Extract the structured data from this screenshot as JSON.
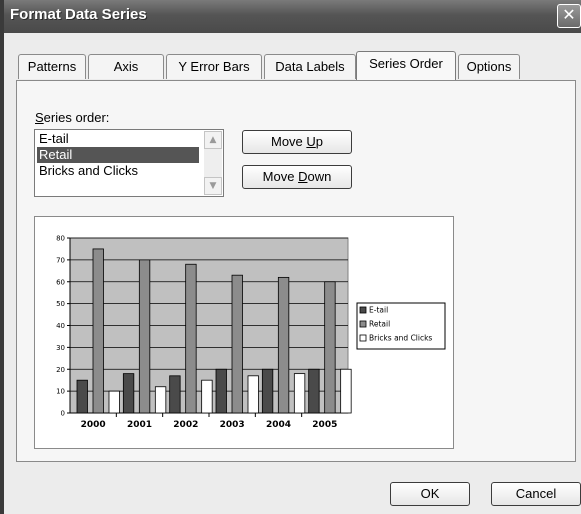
{
  "window": {
    "title": "Format Data Series",
    "close_glyph": "✕"
  },
  "tabs": [
    {
      "label": "Patterns",
      "active": false
    },
    {
      "label": "Axis",
      "active": false
    },
    {
      "label": "Y Error Bars",
      "active": false
    },
    {
      "label": "Data Labels",
      "active": false
    },
    {
      "label": "Series Order",
      "active": true
    },
    {
      "label": "Options",
      "active": false
    }
  ],
  "series_order": {
    "label_mnemonic": "S",
    "label_rest": "eries order:",
    "items": [
      "E-tail",
      "Retail",
      "Bricks and Clicks"
    ],
    "selected_index": 1,
    "move_up": {
      "pre": "Move ",
      "mnemonic": "U",
      "post": "p"
    },
    "move_down": {
      "pre": "Move ",
      "mnemonic": "D",
      "post": "own"
    }
  },
  "chart_data": {
    "type": "bar",
    "categories": [
      "2000",
      "2001",
      "2002",
      "2003",
      "2004",
      "2005"
    ],
    "series": [
      {
        "name": "E-tail",
        "values": [
          15,
          18,
          17,
          20,
          20,
          20
        ],
        "color": "#4a4a4a"
      },
      {
        "name": "Retail",
        "values": [
          75,
          70,
          68,
          63,
          62,
          60
        ],
        "color": "#8c8c8c"
      },
      {
        "name": "Bricks and Clicks",
        "values": [
          10,
          12,
          15,
          17,
          18,
          20
        ],
        "color": "#ffffff"
      }
    ],
    "ylim": [
      0,
      80
    ],
    "yticks": [
      "0",
      "10",
      "20",
      "30",
      "40",
      "50",
      "60",
      "70",
      "80"
    ],
    "grid": true,
    "plot_background": "#c0c0c0",
    "legend_position": "right"
  },
  "footer": {
    "ok_label": "OK",
    "cancel_label": "Cancel"
  }
}
